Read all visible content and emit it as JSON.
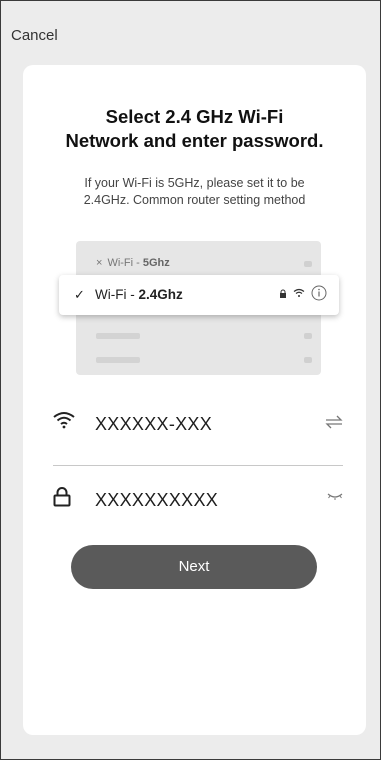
{
  "header": {
    "cancel_label": "Cancel"
  },
  "card": {
    "title_line1": "Select 2.4 GHz Wi-Fi",
    "title_line2": "Network and enter password.",
    "subtitle_line1": "If your Wi-Fi is 5GHz, please set it to be",
    "subtitle_line2": "2.4GHz. Common router setting method"
  },
  "illustration": {
    "row_5g_prefix": "Wi-Fi - ",
    "row_5g_band": "5Ghz",
    "row_24_prefix": "Wi-Fi - ",
    "row_24_band": "2.4Ghz",
    "check_symbol": "✓",
    "x_symbol": "×"
  },
  "wifi_field": {
    "value": "XXXXXX-XXX",
    "icon": "wifi-icon",
    "action_icon": "switch-network-icon"
  },
  "password_field": {
    "value": "XXXXXXXXXX",
    "icon": "lock-icon",
    "action_icon": "eye-closed-icon"
  },
  "next_button": {
    "label": "Next"
  },
  "colors": {
    "button_bg": "#5a5a5a",
    "card_bg": "#ffffff",
    "page_bg": "#ececec"
  }
}
